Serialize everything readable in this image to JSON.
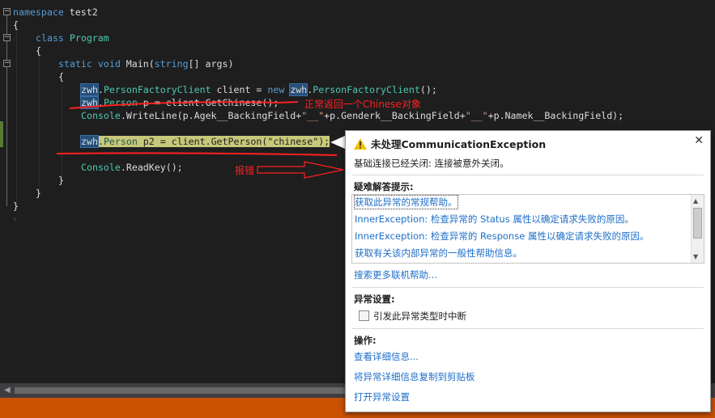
{
  "code": {
    "l1_kw": "namespace",
    "l1_name": " test2",
    "l3_kw": "class",
    "l3_name": "Program",
    "l5_kw1": "static",
    "l5_kw2": "void",
    "l5_name": " Main(",
    "l5_kw3": "string",
    "l5_rest": "[] args)",
    "l7_ns": "zwh",
    "l7_type": "PersonFactoryClient",
    "l7_mid": " client = ",
    "l7_new": "new",
    "l7_ns2": "zwh",
    "l7_type2": "PersonFactoryClient",
    "l7_end": "();",
    "l8_ns": "zwh",
    "l8_type": "Person",
    "l8_rest": " p = client.GetChinese();",
    "l9_type": "Console",
    "l9_a": ".WriteLine(p.Agek__BackingField+",
    "l9_s1": "\"__\"",
    "l9_b": "+p.Genderk__BackingField+",
    "l9_s2": "\"__\"",
    "l9_c": "+p.Namek__BackingField);",
    "l11_ns": "zwh",
    "l11_type": "Person",
    "l11_rest": " p2 = client.GetPerson(",
    "l11_str": "\"chinese\"",
    "l11_end": ");",
    "l13_type": "Console",
    "l13_rest": ".ReadKey();",
    "brace_open": "{",
    "brace_close": "}"
  },
  "annotations": {
    "normal_return": "正常返回一个Chinese对象",
    "error": "报错"
  },
  "popup": {
    "title": "未处理CommunicationException",
    "message": "基础连接已经关闭: 连接被意外关闭。",
    "tips_heading": "疑难解答提示:",
    "tips": [
      "获取此异常的常规帮助。",
      "InnerException: 检查异常的 Status 属性以确定请求失败的原因。",
      "InnerException: 检查异常的 Response 属性以确定请求失败的原因。",
      "获取有关该内部异常的一般性帮助信息。"
    ],
    "search_link": "搜索更多联机帮助...",
    "exception_settings_heading": "异常设置:",
    "break_checkbox_label": "引发此异常类型时中断",
    "actions_heading": "操作:",
    "actions": [
      "查看详细信息...",
      "将异常详细信息复制到剪贴板",
      "打开异常设置"
    ]
  },
  "colors": {
    "editor_bg": "#1e1e1e",
    "keyword": "#569cd6",
    "type": "#4ec9b0",
    "string": "#d69d85",
    "status_bar": "#ca5100",
    "link": "#1e6ec8",
    "annotation": "#ff2020"
  }
}
